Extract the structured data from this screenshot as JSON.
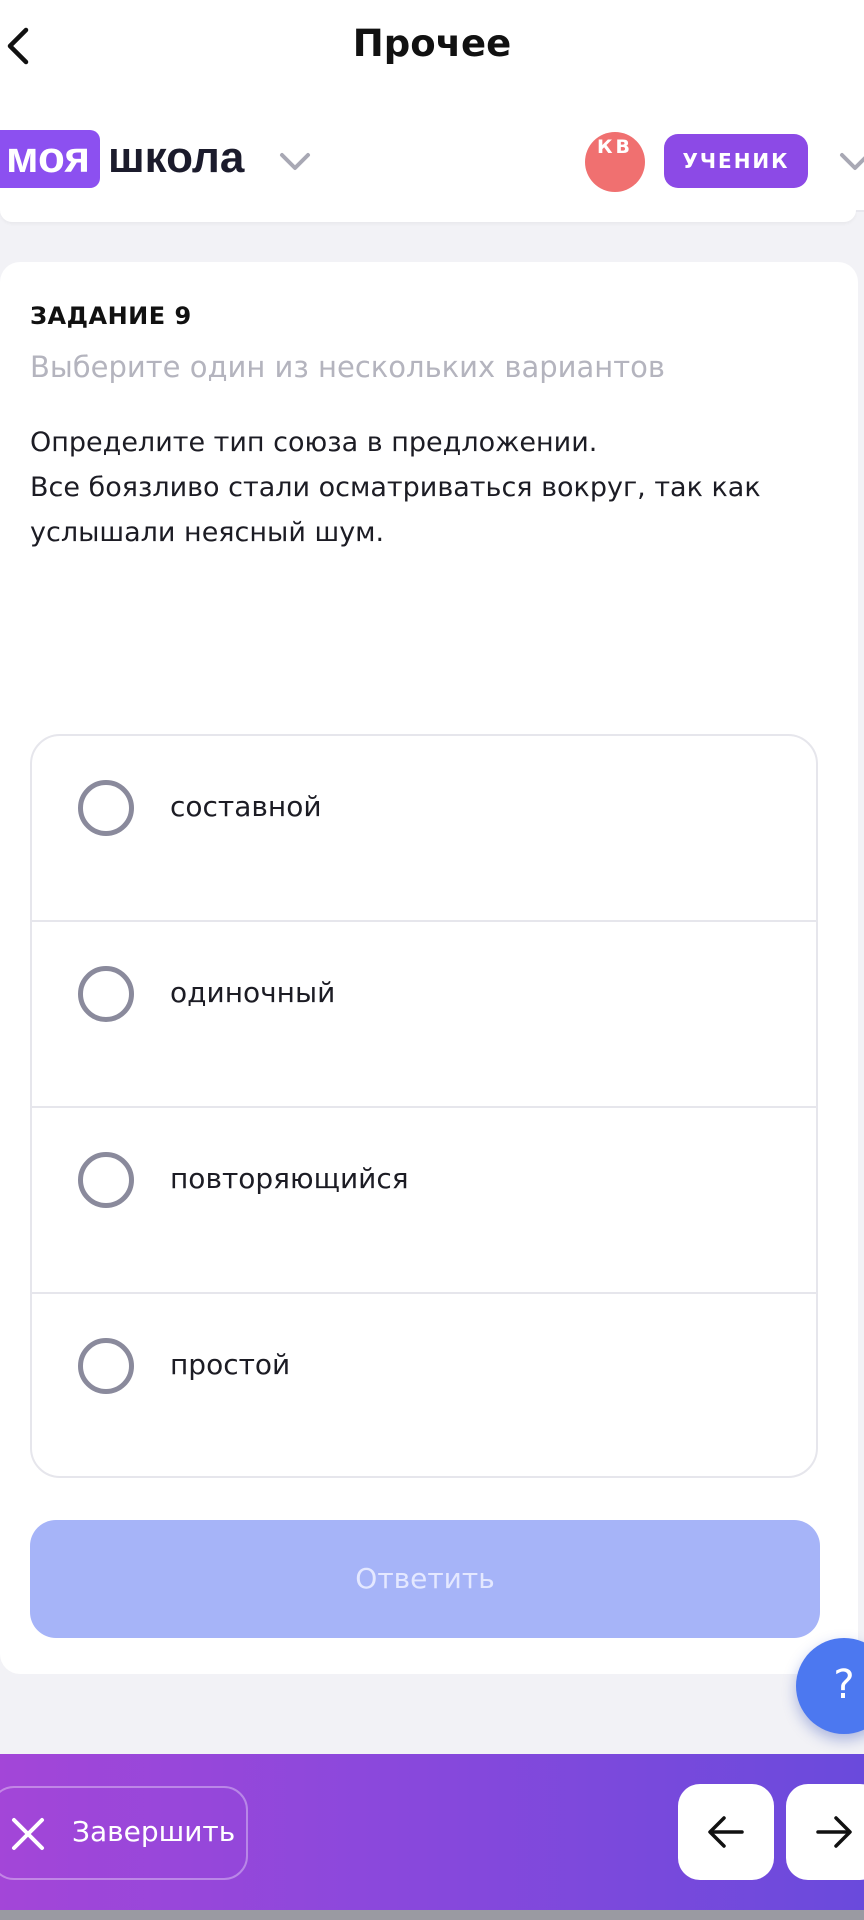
{
  "topbar": {
    "title": "Прочее"
  },
  "school_header": {
    "logo_part1": "моя",
    "logo_part2": "школа",
    "avatar_initials": "КВ",
    "role": "УЧЕНИК"
  },
  "task": {
    "number": "ЗАДАНИЕ 9",
    "hint": "Выберите один из нескольких вариантов",
    "text_lines": [
      "Определите тип союза в предложении.",
      "Все боязливо стали осматриваться вокруг, так как",
      "услышали неясный шум."
    ],
    "options": [
      "составной",
      "одиночный",
      "повторяющийся",
      "простой"
    ],
    "answer_button": "Ответить"
  },
  "help": {
    "label": "?"
  },
  "bottom_bar": {
    "finish_label": "Завершить"
  },
  "colors": {
    "brand_purple": "#8c50f0",
    "role_badge": "#8c4ae6",
    "avatar": "#f07070",
    "answer_disabled": "#a6b4f8",
    "help": "#4c78f0"
  },
  "icons": {
    "back": "chevron-left-icon",
    "school_dropdown": "chevron-down-icon",
    "close": "close-icon",
    "prev": "arrow-left-icon",
    "next": "arrow-right-icon"
  }
}
